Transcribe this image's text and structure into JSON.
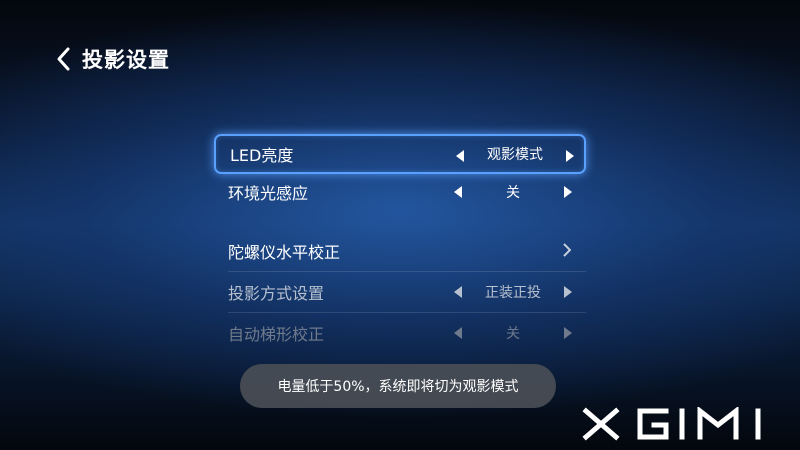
{
  "header": {
    "title": "投影设置"
  },
  "menu": {
    "items": [
      {
        "label": "LED亮度",
        "value": "观影模式"
      },
      {
        "label": "环境光感应",
        "value": "关"
      },
      {
        "label": "陀螺仪水平校正"
      },
      {
        "label": "投影方式设置",
        "value": "正装正投"
      },
      {
        "label": "自动梯形校正",
        "value": "关"
      }
    ]
  },
  "toast": {
    "text": "电量低于50%，系统即将切为观影模式"
  },
  "brand": {
    "logo_text": "XGIMI"
  },
  "colors": {
    "focus_border": "#5aa0ff",
    "toast_bg": "#4a4e56"
  }
}
